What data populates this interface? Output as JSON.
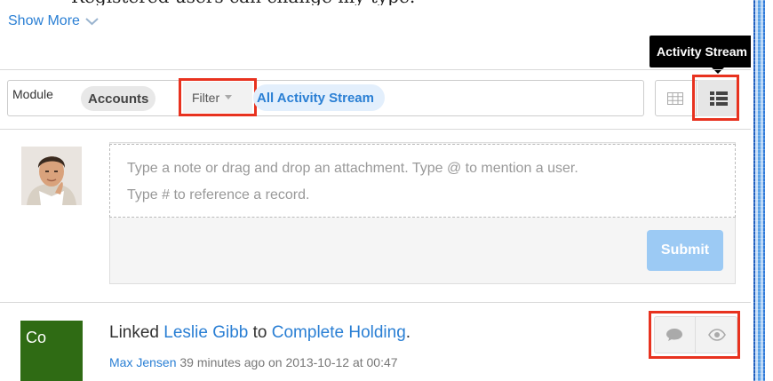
{
  "show_more": {
    "label": "Show More"
  },
  "tooltip": {
    "text": "Activity Stream"
  },
  "filter_bar": {
    "module_label": "Module",
    "module_value": "Accounts",
    "filter_label": "Filter",
    "stream_label": "All Activity Stream"
  },
  "view_toggle": {
    "grid_icon": "grid-view-icon",
    "list_icon": "list-view-icon",
    "active": "list"
  },
  "note": {
    "placeholder_line1": "Type a note or drag and drop an attachment. Type @ to mention a user.",
    "placeholder_line2": "Type # to reference a record.",
    "submit_label": "Submit"
  },
  "activity": {
    "badge": "Co",
    "prefix": "Linked",
    "linked_record": "Leslie Gibb",
    "connector": "to",
    "target_record": "Complete Holding",
    "suffix": ".",
    "author": "Max Jensen",
    "time": "39 minutes ago on 2013-10-12 at 00:47",
    "actions": [
      "comment-icon",
      "eye-icon"
    ]
  },
  "colors": {
    "link": "#2a7fd4",
    "highlight": "#e8321f",
    "badge": "#2f6b14",
    "submit": "#9ccaf4",
    "tooltip_bg": "#000000"
  }
}
